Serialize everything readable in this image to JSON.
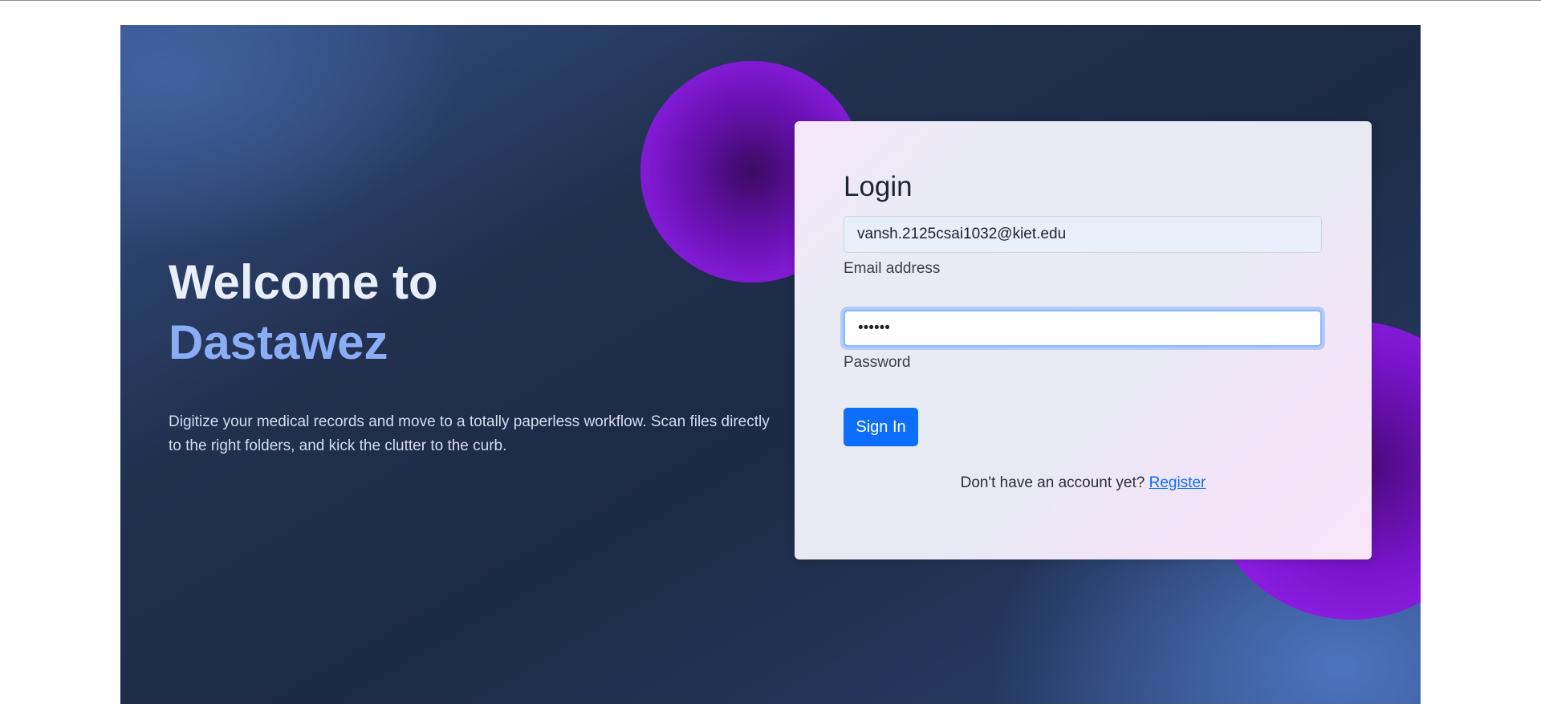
{
  "hero": {
    "welcome_line1": "Welcome to",
    "brand_name": "Dastawez",
    "tagline": "Digitize your medical records and move to a totally paperless workflow. Scan files directly to the right folders, and kick the clutter to the curb."
  },
  "login": {
    "title": "Login",
    "email_value": "vansh.2125csai1032@kiet.edu",
    "email_label": "Email address",
    "password_value": "••••••",
    "password_label": "Password",
    "signin_label": "Sign In",
    "register_prompt": "Don't have an account yet?",
    "register_link": "Register"
  },
  "colors": {
    "accent": "#0d6efd",
    "brand_text": "#8aaef5",
    "blob": "#8b1ee0"
  }
}
